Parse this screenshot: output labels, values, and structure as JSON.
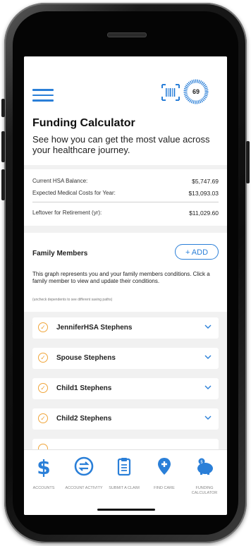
{
  "header": {
    "score": "69",
    "title": "Funding Calculator",
    "subtitle": "See how you can get the most value across your healthcare journey."
  },
  "balances": [
    {
      "label": "Current HSA Balance:",
      "value": "$5,747.69"
    },
    {
      "label": "Expected Medical Costs for Year:",
      "value": "$13,093.03"
    },
    {
      "label": "Leftover for Retirement (yr):",
      "value": "$11,029.60"
    }
  ],
  "family": {
    "title": "Family Members",
    "add_label": "+ ADD",
    "description": "This graph represents you and your family members conditions. Click a family member to view and update their conditions.",
    "hint": "(uncheck dependents to see different saving paths)",
    "members": [
      {
        "name": "JenniferHSA Stephens"
      },
      {
        "name": "Spouse Stephens"
      },
      {
        "name": "Child1 Stephens"
      },
      {
        "name": "Child2 Stephens"
      }
    ]
  },
  "nav": [
    {
      "label": "ACCOUNTS",
      "icon": "dollar-icon"
    },
    {
      "label": "ACCOUNT ACTIVITY",
      "icon": "transfer-icon"
    },
    {
      "label": "SUBMIT A CLAIM",
      "icon": "clipboard-icon"
    },
    {
      "label": "FIND CARE",
      "icon": "location-pin-icon"
    },
    {
      "label": "FUNDING CALCULATOR",
      "icon": "piggy-bank-icon"
    }
  ],
  "colors": {
    "accent": "#2a7fd8",
    "check": "#f0a53a",
    "status": "#f5c400"
  }
}
